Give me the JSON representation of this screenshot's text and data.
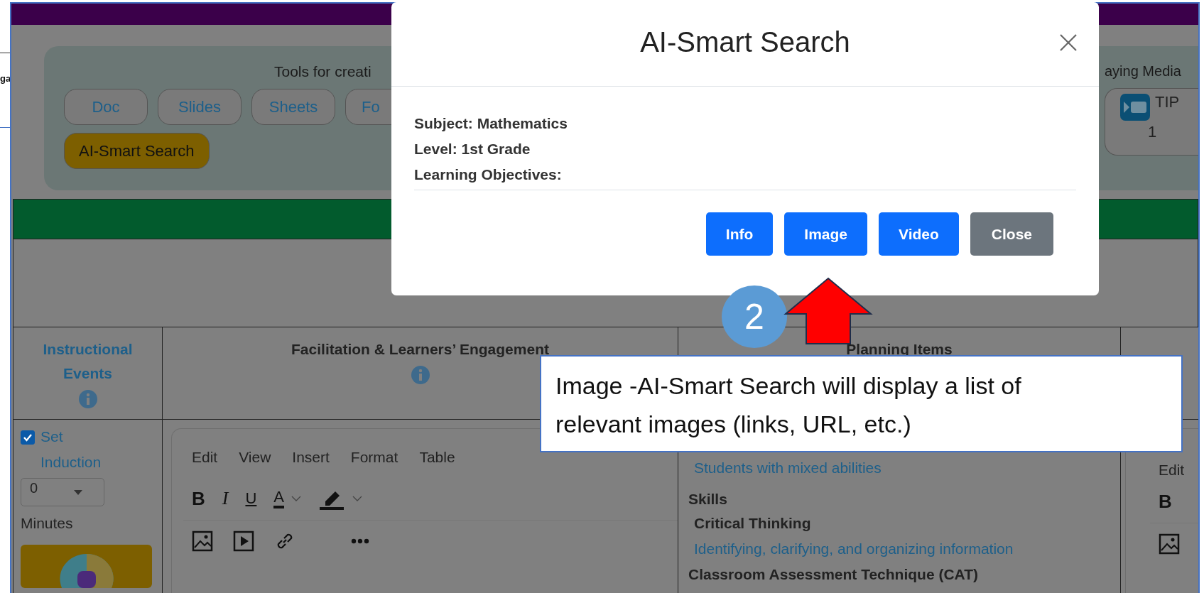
{
  "edge_text": "ga",
  "tools_panel": {
    "title": "Tools for creati",
    "buttons": [
      {
        "label": "Doc",
        "selected": false
      },
      {
        "label": "Slides",
        "selected": false
      },
      {
        "label": "Sheets",
        "selected": false
      },
      {
        "label": "Fo",
        "selected": false
      },
      {
        "label": "AI-Smart Search",
        "selected": true
      }
    ],
    "media_title": "aying Media",
    "media_button": {
      "label": "TIP",
      "number": "1"
    }
  },
  "table": {
    "columns": [
      {
        "label": "Instructional Events",
        "kind": "link",
        "info": true
      },
      {
        "label": "Facilitation & Learners’ Engagement",
        "kind": "plain",
        "info": true
      },
      {
        "label": "Planning Items",
        "kind": "plain",
        "info": false
      }
    ],
    "event": {
      "label": "Set Induction",
      "checked": true,
      "minutes_value": "0",
      "minutes_label": "Minutes"
    },
    "editor": {
      "menu": [
        "Edit",
        "View",
        "Insert",
        "Format",
        "Table"
      ],
      "format_buttons": [
        {
          "glyph": "B",
          "kind": "bold"
        },
        {
          "glyph": "I",
          "kind": "italic"
        },
        {
          "glyph": "U",
          "kind": "underline"
        },
        {
          "glyph": "A",
          "kind": "color"
        }
      ]
    },
    "planning": [
      {
        "text": "Students with mixed abilities",
        "kind": "link"
      },
      {
        "text": "Skills",
        "kind": "heading"
      },
      {
        "text": "Critical Thinking",
        "kind": "subheading"
      },
      {
        "text": "Identifying, clarifying, and organizing information",
        "kind": "link"
      },
      {
        "text": "Classroom Assessment Technique (CAT)",
        "kind": "heading"
      }
    ],
    "side_editor": {
      "menu": [
        "Edit"
      ],
      "format_buttons": [
        {
          "glyph": "B",
          "kind": "bold"
        }
      ]
    }
  },
  "modal": {
    "title": "AI-Smart Search",
    "fields": [
      {
        "label": "Subject:",
        "value": "Mathematics"
      },
      {
        "label": "Level:",
        "value": "1st Grade"
      },
      {
        "label": "Learning Objectives:"
      }
    ],
    "buttons": [
      {
        "label": "Info",
        "kind": "primary"
      },
      {
        "label": "Image",
        "kind": "primary"
      },
      {
        "label": "Video",
        "kind": "primary"
      },
      {
        "label": "Close",
        "kind": "secondary"
      }
    ]
  },
  "annotation": {
    "step": "2",
    "text": "Image -AI-Smart Search will display a list of relevant images (links, URL, etc.)"
  }
}
